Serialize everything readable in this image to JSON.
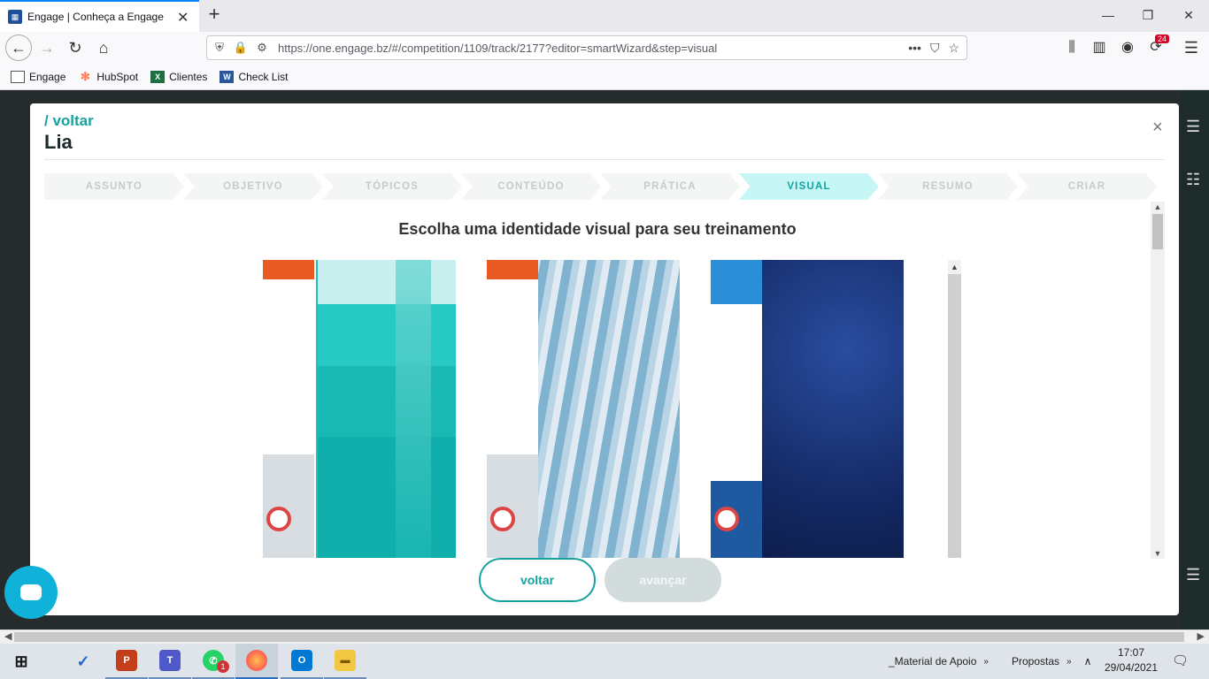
{
  "browser": {
    "tab_title": "Engage | Conheça a Engage",
    "url": "https://one.engage.bz/#/competition/1109/track/2177?editor=smartWizard&step=visual",
    "notification_count": "24",
    "bookmarks": [
      {
        "label": "Engage",
        "icon": "folder-icon"
      },
      {
        "label": "HubSpot",
        "icon": "hubspot-icon"
      },
      {
        "label": "Clientes",
        "icon": "excel-icon"
      },
      {
        "label": "Check List",
        "icon": "word-icon"
      }
    ]
  },
  "modal": {
    "back_link": "/ voltar",
    "title": "Lia",
    "close": "×",
    "steps": [
      "ASSUNTO",
      "OBJETIVO",
      "TÓPICOS",
      "CONTEÚDO",
      "PRÁTICA",
      "VISUAL",
      "RESUMO",
      "CRIAR"
    ],
    "active_step": "VISUAL",
    "heading": "Escolha uma identidade visual para seu treinamento",
    "buttons": {
      "back": "voltar",
      "next": "avançar"
    }
  },
  "taskbar": {
    "tray_items": [
      "_Material de Apoio",
      "Propostas"
    ],
    "time": "17:07",
    "date": "29/04/2021",
    "whatsapp_badge": "1"
  },
  "colors": {
    "accent": "#17a2a0",
    "active_step_bg": "#c7f6f6",
    "chat": "#10b2d9"
  }
}
